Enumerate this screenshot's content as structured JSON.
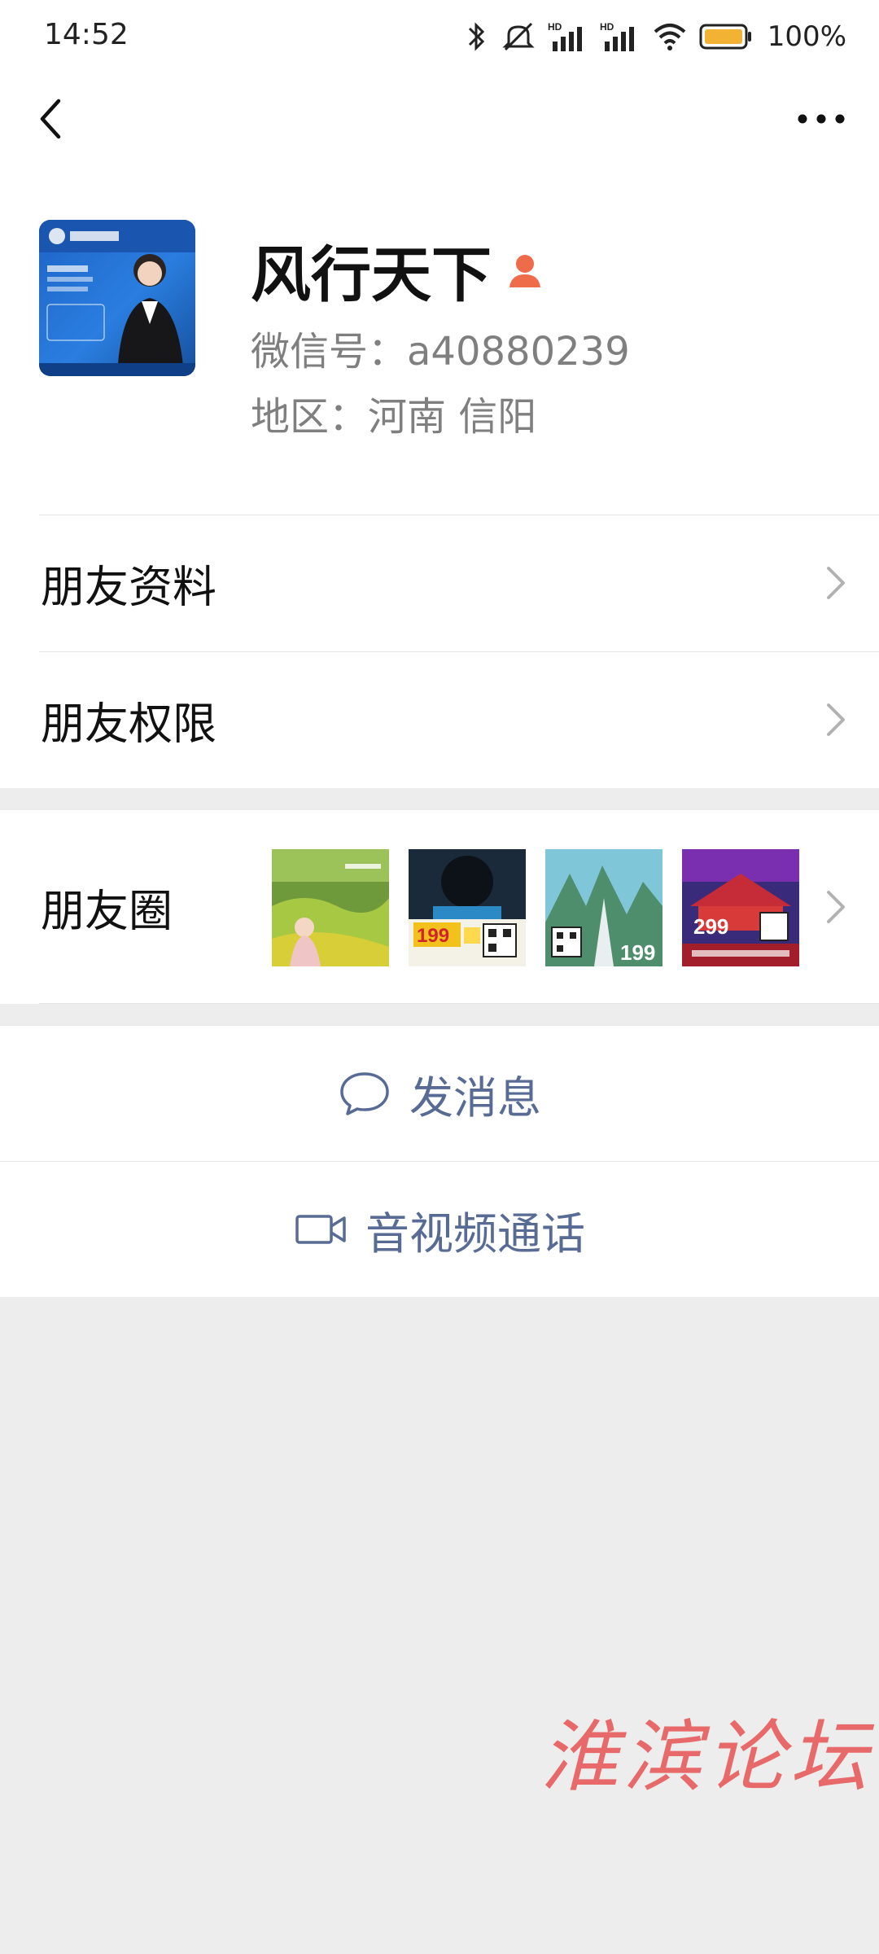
{
  "status_bar": {
    "time": "14:52",
    "battery_percent": "100%",
    "signal_label_1": "HD",
    "signal_label_2": "HD"
  },
  "nav": {
    "back_icon": "chevron-left-icon",
    "more_icon": "more-horizontal-icon"
  },
  "profile": {
    "name": "风行天下",
    "wechat_id": "微信号：a40880239",
    "region": "地区：河南  信阳",
    "gender_icon": "female-icon",
    "accent_color": "#ef6c4a"
  },
  "menu": {
    "friend_info": "朋友资料",
    "friend_permissions": "朋友权限",
    "moments": "朋友圈"
  },
  "moments_thumbs": [
    {
      "label": "",
      "price": ""
    },
    {
      "label": "",
      "price": "199"
    },
    {
      "label": "",
      "price": "199"
    },
    {
      "label": "",
      "price": "299"
    }
  ],
  "actions": {
    "send_message": "发消息",
    "video_call": "音视频通话",
    "link_color": "#576b95"
  },
  "watermark": "淮滨论坛"
}
